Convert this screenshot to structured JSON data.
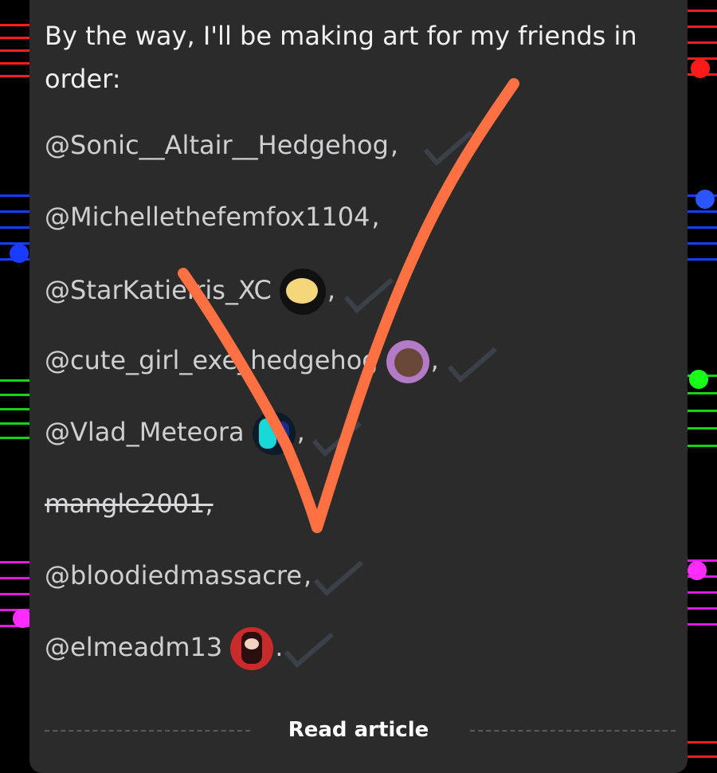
{
  "post": {
    "intro": "By the way, I'll be making art for my friends in order:",
    "mentions": [
      {
        "handle": "@Sonic__Altair__Hedgehog",
        "suffix": ","
      },
      {
        "handle": "@Michellethefemfox1104",
        "suffix": ","
      },
      {
        "handle": "@StarKatieIris_XC",
        "suffix": ","
      },
      {
        "handle": "@cute_girl_exe_hedgehog",
        "suffix": ","
      },
      {
        "handle": "@Vlad_Meteora",
        "suffix": ","
      },
      {
        "handle": "mangle2001,",
        "suffix": ""
      },
      {
        "handle": "@bloodiedmassacre",
        "suffix": ","
      },
      {
        "handle": "@elmeadm13",
        "suffix": "."
      }
    ]
  },
  "footer": {
    "read_label": "Read article"
  },
  "colors": {
    "card_bg": "#2b2b2c",
    "check_mark": "#ff7043",
    "staff_red": "#ff1a1a",
    "staff_blue": "#1a3cff",
    "staff_green": "#12d412",
    "staff_magenta": "#e01ae0"
  },
  "icons": [
    "check-icon",
    "music-note-icon",
    "avatar"
  ]
}
